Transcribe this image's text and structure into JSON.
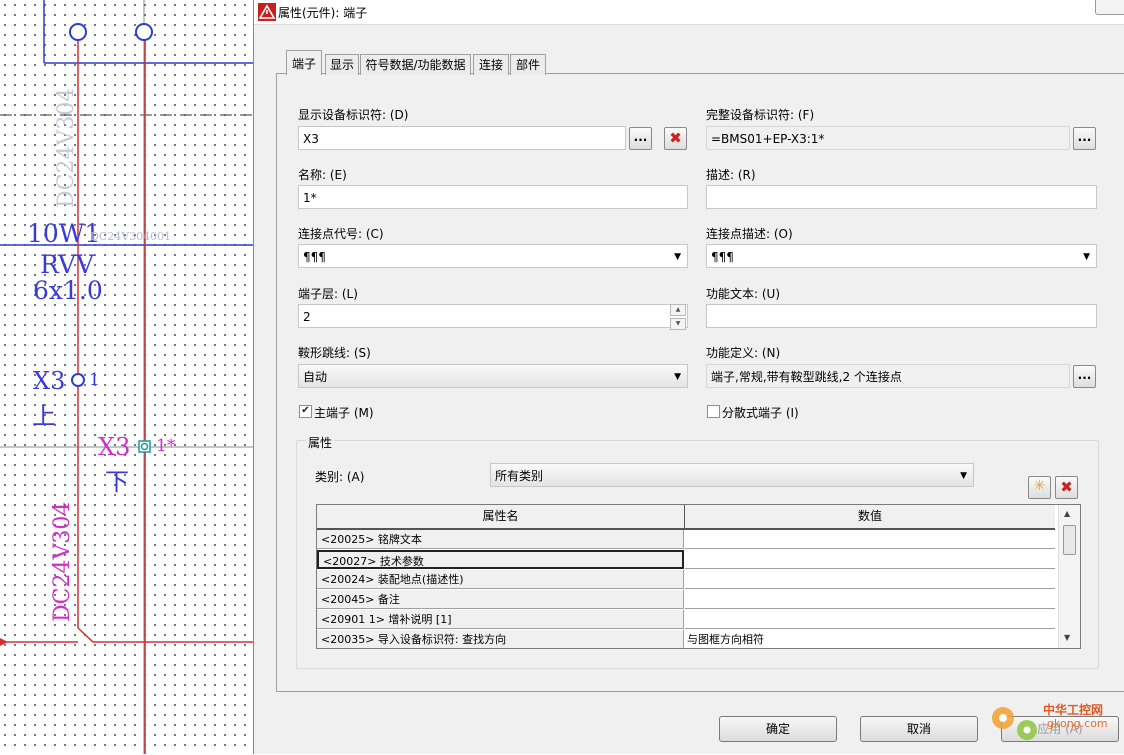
{
  "schematic": {
    "cable_tag": "10W1",
    "cable_type": "RVV",
    "cable_spec": "6x1.0",
    "cable_wire_top": "DC24V304",
    "cable_ref": "DC24V304001",
    "term_upper_tag": "X3",
    "term_upper_num": "1",
    "term_upper_pos": "上",
    "term_lower_tag": "X3",
    "term_lower_num": "1*",
    "term_lower_pos": "下",
    "wire_vertical_label": "DC24V304",
    "colors": {
      "wire_red": "#d23030",
      "wire_blue": "#2a3fd0",
      "label_magenta": "#d030c8",
      "label_blue": "#3a3adc"
    }
  },
  "dialog": {
    "title": "属性(元件): 端子",
    "tabs": [
      "端子",
      "显示",
      "符号数据/功能数据",
      "连接",
      "部件"
    ],
    "active_tab": 0,
    "fields": {
      "display_tag_label": "显示设备标识符: (D)",
      "display_tag_value": "X3",
      "full_tag_label": "完整设备标识符: (F)",
      "full_tag_value": "=BMS01+EP-X3:1*",
      "name_label": "名称: (E)",
      "name_value": "1*",
      "desc_label": "描述: (R)",
      "desc_value": "",
      "conn_code_label": "连接点代号: (C)",
      "conn_code_value": "¶¶¶",
      "conn_desc_label": "连接点描述: (O)",
      "conn_desc_value": "¶¶¶",
      "level_label": "端子层: (L)",
      "level_value": "2",
      "func_text_label": "功能文本: (U)",
      "func_text_value": "",
      "jumper_label": "鞍形跳线: (S)",
      "jumper_value": "自动",
      "func_def_label": "功能定义: (N)",
      "func_def_value": "端子,常规,带有鞍型跳线,2 个连接点",
      "main_terminal_label": "主端子 (M)",
      "main_terminal_checked": true,
      "split_terminal_label": "分散式端子 (I)",
      "split_terminal_checked": false,
      "ellipsis": "...",
      "delete_glyph": "✖",
      "add_glyph": "✳"
    },
    "properties": {
      "group_label": "属性",
      "category_label": "类别: (A)",
      "category_value": "所有类别",
      "col_name": "属性名",
      "col_value": "数值",
      "rows": [
        {
          "name": "<20025> 铭牌文本",
          "value": ""
        },
        {
          "name": "<20027> 技术参数",
          "value": ""
        },
        {
          "name": "<20024> 装配地点(描述性)",
          "value": ""
        },
        {
          "name": "<20045> 备注",
          "value": ""
        },
        {
          "name": "<20901 1> 增补说明 [1]",
          "value": ""
        },
        {
          "name": "<20035> 导入设备标识符: 查找方向",
          "value": "与图框方向相符"
        }
      ]
    },
    "buttons": {
      "ok": "确定",
      "cancel": "取消",
      "apply": "应用 (A)"
    },
    "watermark": {
      "cn": "中华工控网",
      "url": "gkong.com"
    }
  }
}
